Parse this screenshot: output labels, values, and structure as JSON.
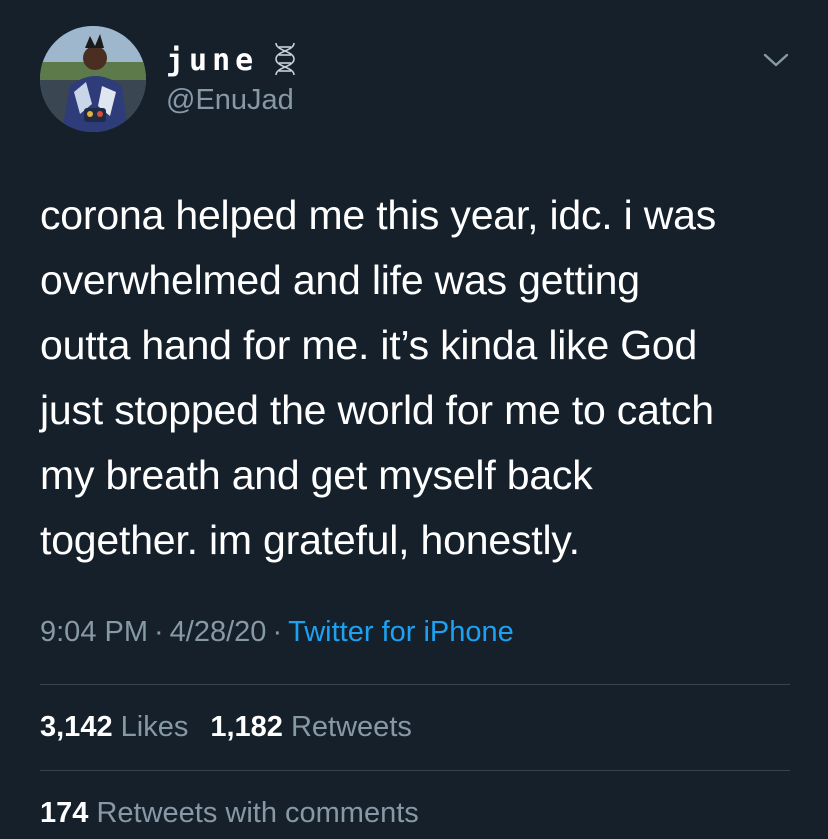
{
  "user": {
    "display_name": "june",
    "handle": "@EnuJad",
    "name_icon": "dna-icon",
    "avatar_icon": "avatar"
  },
  "tweet": {
    "text": "corona helped me this year, idc. i was\noverwhelmed and life was getting\noutta hand for me. it’s kinda like God\njust stopped the world for me to catch\nmy breath and get myself back\ntogether. im grateful, honestly.",
    "time": "9:04 PM",
    "date": "4/28/20",
    "separator": "·",
    "source": "Twitter for iPhone"
  },
  "stats": {
    "likes_count": "3,142",
    "likes_label": "Likes",
    "retweets_count": "1,182",
    "retweets_label": "Retweets",
    "quotes_count": "174",
    "quotes_label": "Retweets with comments"
  },
  "colors": {
    "background": "#15202b",
    "text": "#ffffff",
    "secondary": "#8899a6",
    "link": "#1da1f2",
    "divider": "#38444d"
  },
  "icons": {
    "menu": "chevron-down-icon"
  }
}
